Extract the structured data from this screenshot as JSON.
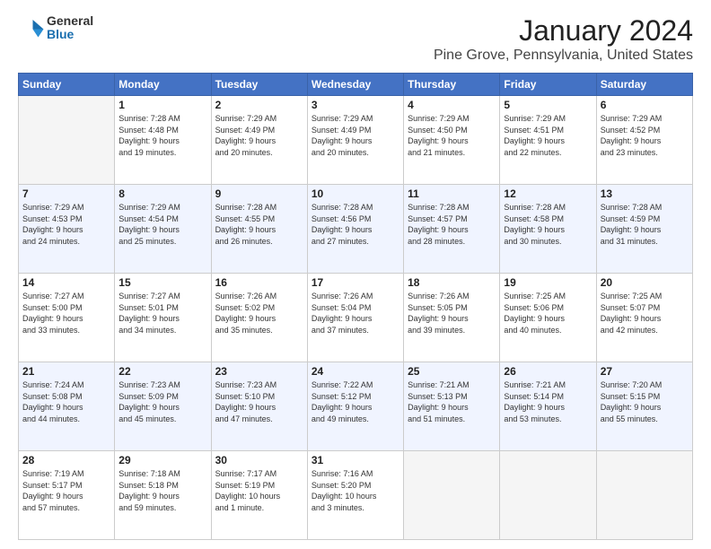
{
  "logo": {
    "general": "General",
    "blue": "Blue"
  },
  "title": "January 2024",
  "subtitle": "Pine Grove, Pennsylvania, United States",
  "days_header": [
    "Sunday",
    "Monday",
    "Tuesday",
    "Wednesday",
    "Thursday",
    "Friday",
    "Saturday"
  ],
  "weeks": [
    [
      {
        "num": "",
        "info": ""
      },
      {
        "num": "1",
        "info": "Sunrise: 7:28 AM\nSunset: 4:48 PM\nDaylight: 9 hours\nand 19 minutes."
      },
      {
        "num": "2",
        "info": "Sunrise: 7:29 AM\nSunset: 4:49 PM\nDaylight: 9 hours\nand 20 minutes."
      },
      {
        "num": "3",
        "info": "Sunrise: 7:29 AM\nSunset: 4:49 PM\nDaylight: 9 hours\nand 20 minutes."
      },
      {
        "num": "4",
        "info": "Sunrise: 7:29 AM\nSunset: 4:50 PM\nDaylight: 9 hours\nand 21 minutes."
      },
      {
        "num": "5",
        "info": "Sunrise: 7:29 AM\nSunset: 4:51 PM\nDaylight: 9 hours\nand 22 minutes."
      },
      {
        "num": "6",
        "info": "Sunrise: 7:29 AM\nSunset: 4:52 PM\nDaylight: 9 hours\nand 23 minutes."
      }
    ],
    [
      {
        "num": "7",
        "info": "Sunrise: 7:29 AM\nSunset: 4:53 PM\nDaylight: 9 hours\nand 24 minutes."
      },
      {
        "num": "8",
        "info": "Sunrise: 7:29 AM\nSunset: 4:54 PM\nDaylight: 9 hours\nand 25 minutes."
      },
      {
        "num": "9",
        "info": "Sunrise: 7:28 AM\nSunset: 4:55 PM\nDaylight: 9 hours\nand 26 minutes."
      },
      {
        "num": "10",
        "info": "Sunrise: 7:28 AM\nSunset: 4:56 PM\nDaylight: 9 hours\nand 27 minutes."
      },
      {
        "num": "11",
        "info": "Sunrise: 7:28 AM\nSunset: 4:57 PM\nDaylight: 9 hours\nand 28 minutes."
      },
      {
        "num": "12",
        "info": "Sunrise: 7:28 AM\nSunset: 4:58 PM\nDaylight: 9 hours\nand 30 minutes."
      },
      {
        "num": "13",
        "info": "Sunrise: 7:28 AM\nSunset: 4:59 PM\nDaylight: 9 hours\nand 31 minutes."
      }
    ],
    [
      {
        "num": "14",
        "info": "Sunrise: 7:27 AM\nSunset: 5:00 PM\nDaylight: 9 hours\nand 33 minutes."
      },
      {
        "num": "15",
        "info": "Sunrise: 7:27 AM\nSunset: 5:01 PM\nDaylight: 9 hours\nand 34 minutes."
      },
      {
        "num": "16",
        "info": "Sunrise: 7:26 AM\nSunset: 5:02 PM\nDaylight: 9 hours\nand 35 minutes."
      },
      {
        "num": "17",
        "info": "Sunrise: 7:26 AM\nSunset: 5:04 PM\nDaylight: 9 hours\nand 37 minutes."
      },
      {
        "num": "18",
        "info": "Sunrise: 7:26 AM\nSunset: 5:05 PM\nDaylight: 9 hours\nand 39 minutes."
      },
      {
        "num": "19",
        "info": "Sunrise: 7:25 AM\nSunset: 5:06 PM\nDaylight: 9 hours\nand 40 minutes."
      },
      {
        "num": "20",
        "info": "Sunrise: 7:25 AM\nSunset: 5:07 PM\nDaylight: 9 hours\nand 42 minutes."
      }
    ],
    [
      {
        "num": "21",
        "info": "Sunrise: 7:24 AM\nSunset: 5:08 PM\nDaylight: 9 hours\nand 44 minutes."
      },
      {
        "num": "22",
        "info": "Sunrise: 7:23 AM\nSunset: 5:09 PM\nDaylight: 9 hours\nand 45 minutes."
      },
      {
        "num": "23",
        "info": "Sunrise: 7:23 AM\nSunset: 5:10 PM\nDaylight: 9 hours\nand 47 minutes."
      },
      {
        "num": "24",
        "info": "Sunrise: 7:22 AM\nSunset: 5:12 PM\nDaylight: 9 hours\nand 49 minutes."
      },
      {
        "num": "25",
        "info": "Sunrise: 7:21 AM\nSunset: 5:13 PM\nDaylight: 9 hours\nand 51 minutes."
      },
      {
        "num": "26",
        "info": "Sunrise: 7:21 AM\nSunset: 5:14 PM\nDaylight: 9 hours\nand 53 minutes."
      },
      {
        "num": "27",
        "info": "Sunrise: 7:20 AM\nSunset: 5:15 PM\nDaylight: 9 hours\nand 55 minutes."
      }
    ],
    [
      {
        "num": "28",
        "info": "Sunrise: 7:19 AM\nSunset: 5:17 PM\nDaylight: 9 hours\nand 57 minutes."
      },
      {
        "num": "29",
        "info": "Sunrise: 7:18 AM\nSunset: 5:18 PM\nDaylight: 9 hours\nand 59 minutes."
      },
      {
        "num": "30",
        "info": "Sunrise: 7:17 AM\nSunset: 5:19 PM\nDaylight: 10 hours\nand 1 minute."
      },
      {
        "num": "31",
        "info": "Sunrise: 7:16 AM\nSunset: 5:20 PM\nDaylight: 10 hours\nand 3 minutes."
      },
      {
        "num": "",
        "info": ""
      },
      {
        "num": "",
        "info": ""
      },
      {
        "num": "",
        "info": ""
      }
    ]
  ]
}
